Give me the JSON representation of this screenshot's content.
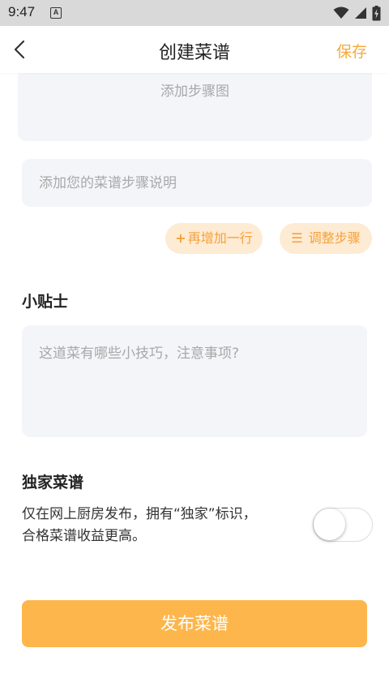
{
  "status_bar": {
    "time": "9:47",
    "notification_badge": "A",
    "icons": [
      "wifi-icon",
      "signal-icon",
      "battery-charging-icon"
    ]
  },
  "nav": {
    "back_icon": "chevron-left-icon",
    "title": "创建菜谱",
    "save_label": "保存"
  },
  "step": {
    "image_placeholder": "添加步骤图",
    "description_placeholder": "添加您的菜谱步骤说明",
    "description_value": "",
    "add_row_glyph": "+",
    "add_row_label": "再增加一行",
    "adjust_glyph": "☰",
    "adjust_label": "调整步骤"
  },
  "tips": {
    "title": "小贴士",
    "placeholder": "这道菜有哪些小技巧，注意事项?",
    "value": ""
  },
  "exclusive": {
    "title": "独家菜谱",
    "description": "仅在网上厨房发布，拥有“独家”标识，合格菜谱收益更高。",
    "enabled": false
  },
  "publish_label": "发布菜谱",
  "colors": {
    "accent": "#f7a83b",
    "publish_button": "#fdb64b",
    "pill_background": "#fdebd3",
    "input_background": "#f4f5f9",
    "placeholder_text": "#a8a8a8"
  }
}
